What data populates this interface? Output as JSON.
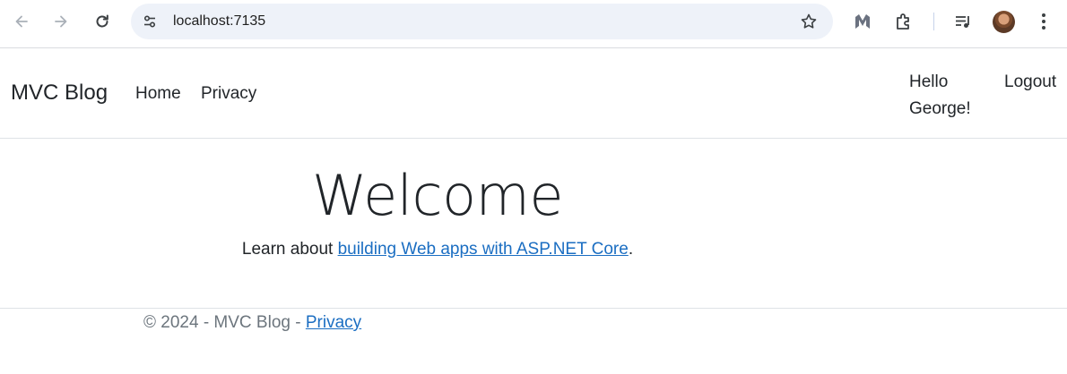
{
  "browser": {
    "url": "localhost:7135",
    "icons": [
      "back-icon",
      "forward-icon",
      "reload-icon",
      "site-settings-icon",
      "bookmark-star-icon",
      "malwarebytes-icon",
      "extensions-icon",
      "reading-list-icon",
      "profile-avatar",
      "menu-icon"
    ]
  },
  "navbar": {
    "brand": "MVC Blog",
    "links": [
      "Home",
      "Privacy"
    ],
    "greeting_line1": "Hello",
    "greeting_line2": "George!",
    "logout": "Logout"
  },
  "main": {
    "heading": "Welcome",
    "lead_prefix": "Learn about ",
    "lead_link": "building Web apps with ASP.NET Core",
    "lead_suffix": "."
  },
  "footer": {
    "copyright": "© 2024 - MVC Blog - ",
    "privacy_link": "Privacy"
  },
  "colors": {
    "link": "#1b6ec2",
    "text": "#212529",
    "muted": "#6c757d",
    "omnibox": "#eef2f9"
  }
}
